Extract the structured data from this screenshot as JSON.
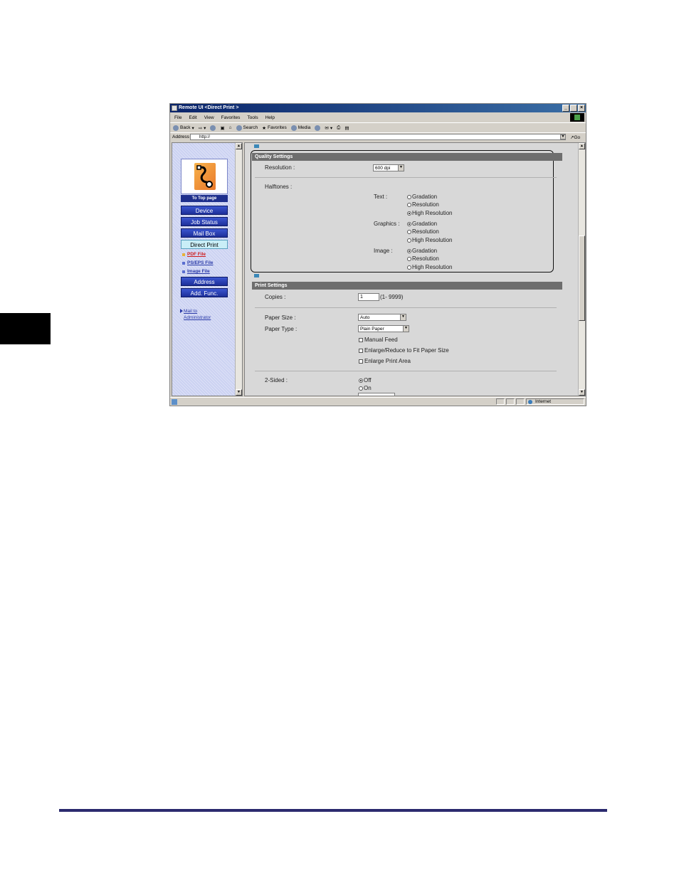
{
  "window": {
    "title": "Remote UI <Direct Print >",
    "controls": [
      "_",
      " ",
      "×"
    ]
  },
  "menu": [
    "File",
    "Edit",
    "View",
    "Favorites",
    "Tools",
    "Help"
  ],
  "toolbar": {
    "back": "Back",
    "search": "Search",
    "favorites": "Favorites",
    "media": "Media"
  },
  "address": {
    "label": "Address",
    "value": "http://",
    "go": "Go"
  },
  "sidebar": {
    "top_page": "To Top page",
    "buttons": [
      "Device",
      "Job Status",
      "Mail Box",
      "Direct Print",
      "Address",
      "Add. Func."
    ],
    "sublinks": [
      "PDF File",
      "PS/EPS File",
      "Image File"
    ],
    "mail_line1": "Mail to",
    "mail_line2": "Administrator"
  },
  "quality": {
    "header": "Quality Settings",
    "resolution_label": "Resolution :",
    "resolution_value": "600 dpi",
    "halftones_label": "Halftones :",
    "text_label": "Text :",
    "graphics_label": "Graphics :",
    "image_label": "Image :",
    "opt_gradation": "Gradation",
    "opt_resolution": "Resolution",
    "opt_high_resolution": "High Resolution",
    "text_selected": "High Resolution",
    "graphics_selected": "Gradation",
    "image_selected": "Gradation"
  },
  "print": {
    "header": "Print Settings",
    "copies_label": "Copies :",
    "copies_value": "1",
    "copies_range": "(1- 9999)",
    "paper_size_label": "Paper Size :",
    "paper_size_value": "Auto",
    "paper_type_label": "Paper Type :",
    "paper_type_value": "Plain Paper",
    "manual_feed": "Manual Feed",
    "enlarge_reduce": "Enlarge/Reduce to Fit Paper Size",
    "enlarge_area": "Enlarge Print Area",
    "two_sided_label": "2-Sided :",
    "off": "Off",
    "on": "On"
  },
  "status": {
    "zone": "Internet"
  }
}
